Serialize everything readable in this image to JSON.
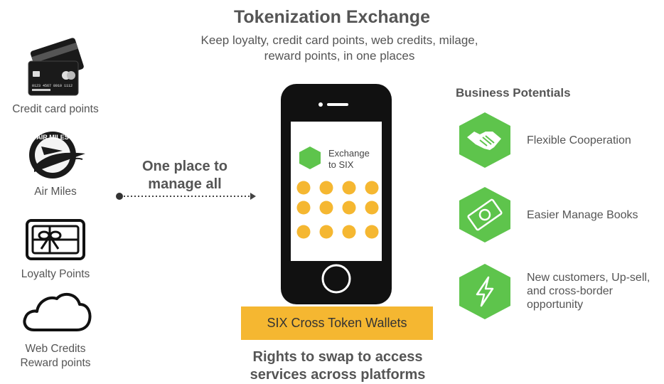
{
  "header": {
    "title": "Tokenization Exchange",
    "subtitle_line1": "Keep loyalty, credit card points, web credits, milage,",
    "subtitle_line2": "reward points, in one places"
  },
  "sources": [
    {
      "icon": "credit-card-icon",
      "label": "Credit card points",
      "card_number": "0123 4567 8910 1112"
    },
    {
      "icon": "air-miles-logo",
      "label": "Air Miles",
      "logo_text": "AIR MILES"
    },
    {
      "icon": "gift-card-icon",
      "label": "Loyalty Points"
    },
    {
      "icon": "cloud-icon",
      "label_line1": "Web Credits",
      "label_line2": "Reward points"
    }
  ],
  "center": {
    "caption_line1": "One place to",
    "caption_line2": "manage all",
    "phone_line1": "Exchange",
    "phone_line2": "to SIX",
    "wallet_label": "SIX Cross Token Wallets",
    "rights_line1": "Rights to swap to access",
    "rights_line2": "services across platforms"
  },
  "business": {
    "title": "Business Potentials",
    "items": [
      {
        "icon": "handshake-icon",
        "label": "Flexible Cooperation"
      },
      {
        "icon": "money-icon",
        "label": "Easier Manage Books"
      },
      {
        "icon": "lightning-icon",
        "line1": "New customers,  Up-sell,",
        "line2": "and cross-border",
        "line3": "opportunity"
      }
    ]
  },
  "colors": {
    "accent_green": "#5ec44c",
    "accent_yellow": "#f5b731",
    "text_gray": "#555555",
    "phone_black": "#111111"
  }
}
